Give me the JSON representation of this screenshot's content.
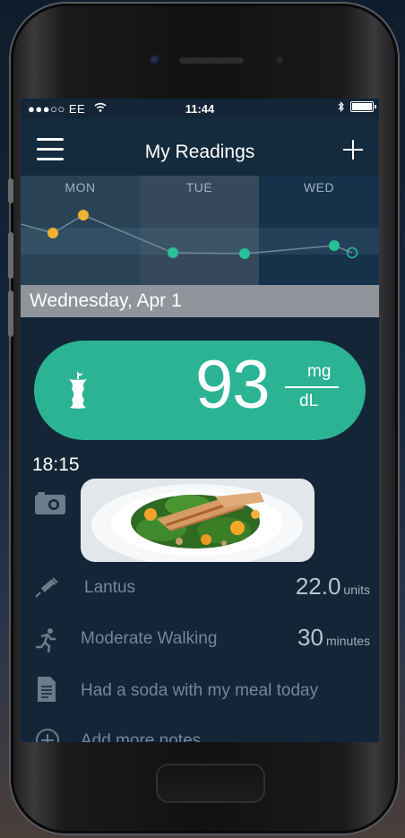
{
  "status_bar": {
    "carrier": "●●●○○ EE",
    "time": "11:44"
  },
  "nav": {
    "title": "My Readings",
    "menu_icon": "hamburger-menu-icon",
    "add_icon": "plus-icon"
  },
  "chart": {
    "days": [
      "MON",
      "TUE",
      "WED"
    ],
    "colors": {
      "high": "#f0b030",
      "normal": "#2bbf98",
      "line": "#6f8798"
    }
  },
  "date_header": "Wednesday, Apr 1",
  "reading": {
    "value": "93",
    "unit_top": "mg",
    "unit_bottom": "dL",
    "icon": "apple-core-icon",
    "color": "#2bb394"
  },
  "entry": {
    "time": "18:15",
    "camera_icon": "camera-icon"
  },
  "notes": [
    {
      "icon": "syringe-icon",
      "label": "Lantus",
      "value": "22.0",
      "unit": "units"
    },
    {
      "icon": "running-icon",
      "label": "Moderate  Walking",
      "value": "30",
      "unit": "minutes"
    },
    {
      "icon": "document-icon",
      "label": "Had a soda with my meal today"
    },
    {
      "icon": "add-circle-icon",
      "label": "Add more notes"
    }
  ]
}
